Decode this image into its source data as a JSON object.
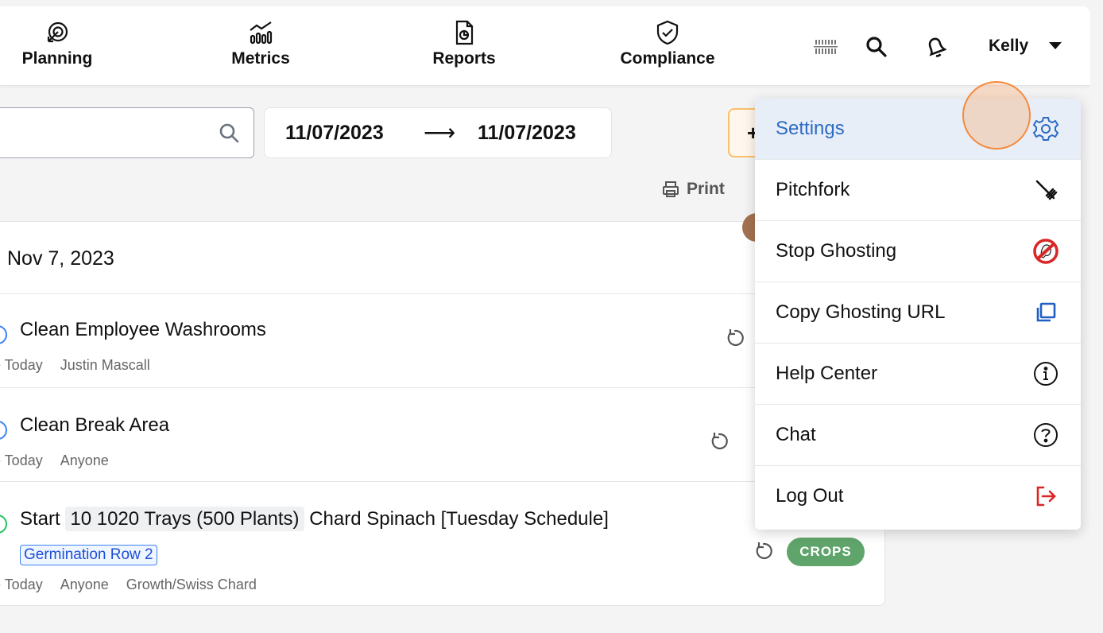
{
  "nav": {
    "items": [
      {
        "label": "Planning",
        "icon": "planning-icon"
      },
      {
        "label": "Metrics",
        "icon": "metrics-icon"
      },
      {
        "label": "Reports",
        "icon": "reports-icon"
      },
      {
        "label": "Compliance",
        "icon": "compliance-icon"
      }
    ],
    "user": "Kelly"
  },
  "filters": {
    "search_placeholder": "",
    "date_start": "11/07/2023",
    "date_arrow": "⟶",
    "date_end": "11/07/2023",
    "orange_button": "+"
  },
  "toolbar": {
    "print_label": "Print"
  },
  "day": {
    "header": "Nov 7, 2023"
  },
  "tasks": [
    {
      "title": "Clean Employee Washrooms",
      "due": "e Today",
      "assignee": "Justin Mascall"
    },
    {
      "title": "Clean Break Area",
      "due": "e Today",
      "assignee": "Anyone"
    },
    {
      "title_prefix": "Start",
      "chip": "10 1020 Trays (500 Plants)",
      "title_suffix": "Chard Spinach [Tuesday Schedule]",
      "location": "Germination Row 2",
      "due": "e Today",
      "assignee": "Anyone",
      "category": "Growth/Swiss Chard",
      "badge": "CROPS"
    }
  ],
  "menu": {
    "items": [
      {
        "label": "Settings",
        "icon": "gear-icon"
      },
      {
        "label": "Pitchfork",
        "icon": "pitchfork-icon"
      },
      {
        "label": "Stop Ghosting",
        "icon": "ghostbusters-icon"
      },
      {
        "label": "Copy Ghosting URL",
        "icon": "copy-icon"
      },
      {
        "label": "Help Center",
        "icon": "info-icon"
      },
      {
        "label": "Chat",
        "icon": "question-icon"
      },
      {
        "label": "Log Out",
        "icon": "logout-icon"
      }
    ]
  },
  "colors": {
    "accent": "#2c6bc4",
    "crops": "#5fa46a",
    "logout": "#dc2626"
  }
}
